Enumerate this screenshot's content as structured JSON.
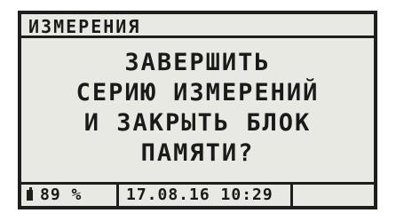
{
  "screen": {
    "title": "ИЗМЕРЕНИЯ",
    "message_lines": [
      "ЗАВЕРШИТЬ",
      "СЕРИЮ ИЗМЕРЕНИЙ",
      "И ЗАКРЫТЬ БЛОК",
      "ПАМЯТИ?"
    ]
  },
  "status": {
    "battery_icon": "battery-icon",
    "battery_percent": "89 %",
    "date": "17.08.16",
    "time": "10:29"
  }
}
